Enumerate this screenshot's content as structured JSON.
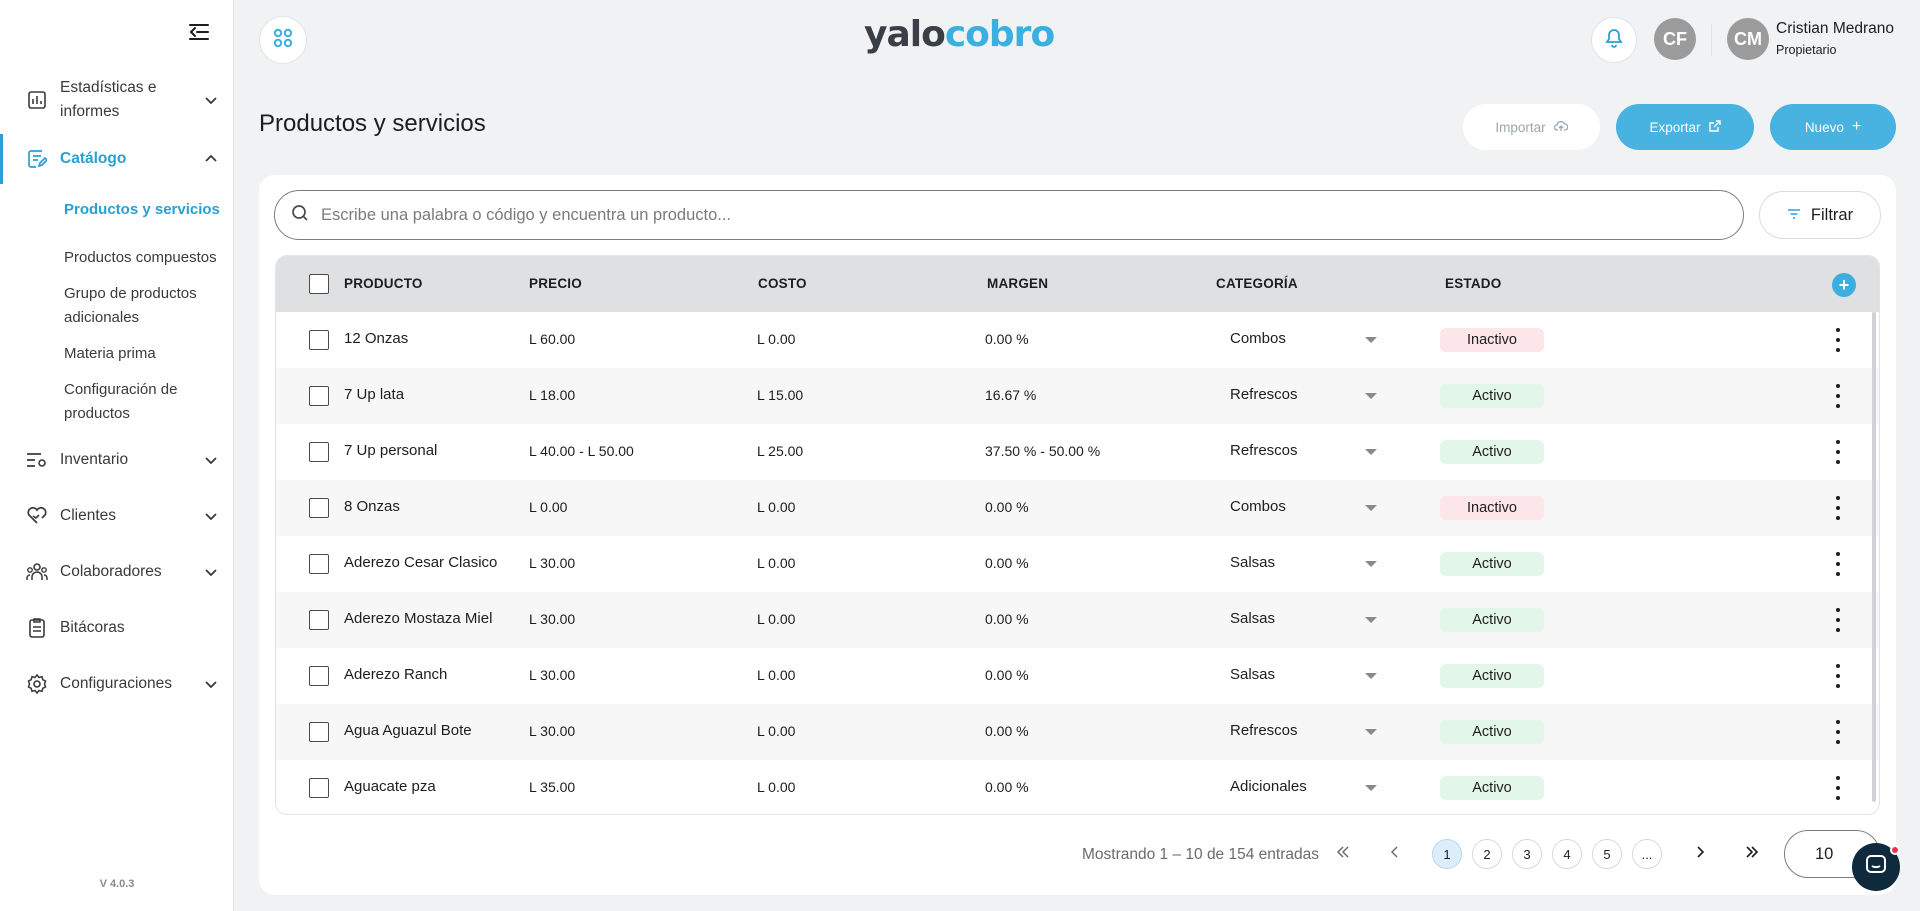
{
  "sidebar": {
    "items": [
      {
        "label": "Estadísticas e informes",
        "icon": "bar-chart-icon",
        "expandable": true
      },
      {
        "label": "Catálogo",
        "icon": "catalog-edit-icon",
        "expandable": true,
        "expanded": true
      },
      {
        "label": "Inventario",
        "icon": "inventory-settings-icon",
        "expandable": true
      },
      {
        "label": "Clientes",
        "icon": "heart-hand-icon",
        "expandable": true
      },
      {
        "label": "Colaboradores",
        "icon": "people-icon",
        "expandable": true
      },
      {
        "label": "Bitácoras",
        "icon": "clipboard-icon",
        "expandable": false
      },
      {
        "label": "Configuraciones",
        "icon": "gear-icon",
        "expandable": true
      }
    ],
    "catalog_sub": [
      "Productos y servicios",
      "Productos compuestos",
      "Grupo de productos adicionales",
      "Materia prima",
      "Configuración de productos"
    ],
    "version": "V 4.0.3"
  },
  "header": {
    "logo_part1": "yalo",
    "logo_part2": "cobro",
    "avatar1": "CF",
    "avatar2": "CM",
    "user_name": "Cristian Medrano",
    "user_role": "Propietario"
  },
  "page": {
    "title": "Productos y servicios",
    "import_label": "Importar",
    "export_label": "Exportar",
    "new_label": "Nuevo"
  },
  "search": {
    "placeholder": "Escribe una palabra o código y encuentra un producto..."
  },
  "filter_label": "Filtrar",
  "table": {
    "headers": [
      "PRODUCTO",
      "PRECIO",
      "COSTO",
      "MARGEN",
      "CATEGORÍA",
      "ESTADO"
    ],
    "rows": [
      {
        "product": "12 Onzas",
        "price": "L 60.00",
        "cost": "L 0.00",
        "margin": "0.00 %",
        "category": "Combos",
        "status": "Inactivo"
      },
      {
        "product": "7 Up lata",
        "price": "L 18.00",
        "cost": "L 15.00",
        "margin": "16.67 %",
        "category": "Refrescos",
        "status": "Activo"
      },
      {
        "product": "7 Up personal",
        "price": "L 40.00 - L 50.00",
        "cost": "L 25.00",
        "margin": "37.50 % - 50.00 %",
        "category": "Refrescos",
        "status": "Activo"
      },
      {
        "product": "8 Onzas",
        "price": "L 0.00",
        "cost": "L 0.00",
        "margin": "0.00 %",
        "category": "Combos",
        "status": "Inactivo"
      },
      {
        "product": "Aderezo Cesar Clasico",
        "price": "L 30.00",
        "cost": "L 0.00",
        "margin": "0.00 %",
        "category": "Salsas",
        "status": "Activo"
      },
      {
        "product": "Aderezo Mostaza Miel",
        "price": "L 30.00",
        "cost": "L 0.00",
        "margin": "0.00 %",
        "category": "Salsas",
        "status": "Activo"
      },
      {
        "product": "Aderezo Ranch",
        "price": "L 30.00",
        "cost": "L 0.00",
        "margin": "0.00 %",
        "category": "Salsas",
        "status": "Activo"
      },
      {
        "product": "Agua Aguazul Bote",
        "price": "L 30.00",
        "cost": "L 0.00",
        "margin": "0.00 %",
        "category": "Refrescos",
        "status": "Activo"
      },
      {
        "product": "Aguacate pza",
        "price": "L 35.00",
        "cost": "L 0.00",
        "margin": "0.00 %",
        "category": "Adicionales",
        "status": "Activo"
      }
    ]
  },
  "pagination": {
    "summary": "Mostrando 1 – 10 de 154 entradas",
    "pages": [
      "1",
      "2",
      "3",
      "4",
      "5",
      "..."
    ],
    "current": "1",
    "first": "«",
    "prev": "‹",
    "next": "›",
    "last": "»",
    "page_size": "10"
  },
  "colors": {
    "accent": "#48b3e0",
    "active_badge": "#e3f6ea",
    "inactive_badge": "#fde6ea"
  }
}
